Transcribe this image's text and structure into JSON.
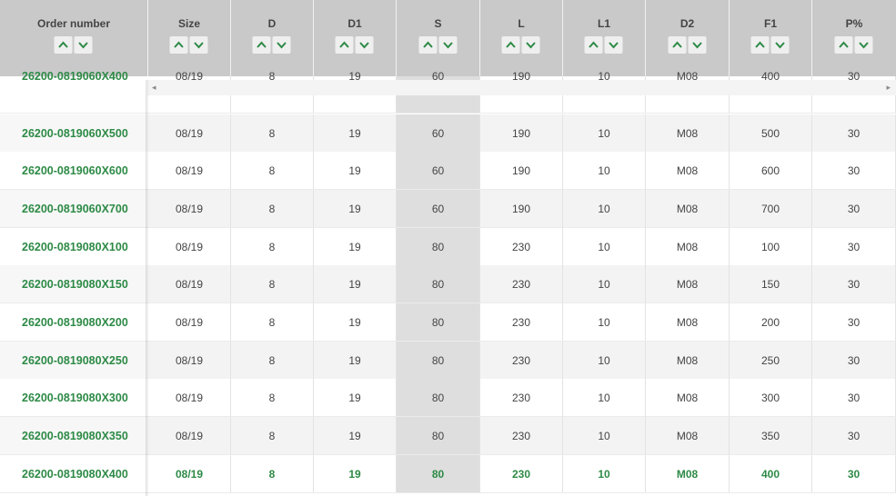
{
  "columns": [
    "Order number",
    "Size",
    "D",
    "D1",
    "S",
    "L",
    "L1",
    "D2",
    "F1",
    "P%"
  ],
  "sort_icons": {
    "up": "chevron-up-icon",
    "down": "chevron-down-icon"
  },
  "colors": {
    "accent": "#2d8a46",
    "header_bg": "#c9c9c9",
    "row_alt": "#f3f3f3",
    "s_column": "#dedede"
  },
  "scrollbar": {
    "left_arrow": "◂",
    "right_arrow": "▸"
  },
  "rows": [
    [
      "26200-0819060X400",
      "08/19",
      "8",
      "19",
      "60",
      "190",
      "10",
      "M08",
      "400",
      "30"
    ],
    [
      "26200-0819060X500",
      "08/19",
      "8",
      "19",
      "60",
      "190",
      "10",
      "M08",
      "500",
      "30"
    ],
    [
      "26200-0819060X600",
      "08/19",
      "8",
      "19",
      "60",
      "190",
      "10",
      "M08",
      "600",
      "30"
    ],
    [
      "26200-0819060X700",
      "08/19",
      "8",
      "19",
      "60",
      "190",
      "10",
      "M08",
      "700",
      "30"
    ],
    [
      "26200-0819080X100",
      "08/19",
      "8",
      "19",
      "80",
      "230",
      "10",
      "M08",
      "100",
      "30"
    ],
    [
      "26200-0819080X150",
      "08/19",
      "8",
      "19",
      "80",
      "230",
      "10",
      "M08",
      "150",
      "30"
    ],
    [
      "26200-0819080X200",
      "08/19",
      "8",
      "19",
      "80",
      "230",
      "10",
      "M08",
      "200",
      "30"
    ],
    [
      "26200-0819080X250",
      "08/19",
      "8",
      "19",
      "80",
      "230",
      "10",
      "M08",
      "250",
      "30"
    ],
    [
      "26200-0819080X300",
      "08/19",
      "8",
      "19",
      "80",
      "230",
      "10",
      "M08",
      "300",
      "30"
    ],
    [
      "26200-0819080X350",
      "08/19",
      "8",
      "19",
      "80",
      "230",
      "10",
      "M08",
      "350",
      "30"
    ],
    [
      "26200-0819080X400",
      "08/19",
      "8",
      "19",
      "80",
      "230",
      "10",
      "M08",
      "400",
      "30"
    ]
  ]
}
